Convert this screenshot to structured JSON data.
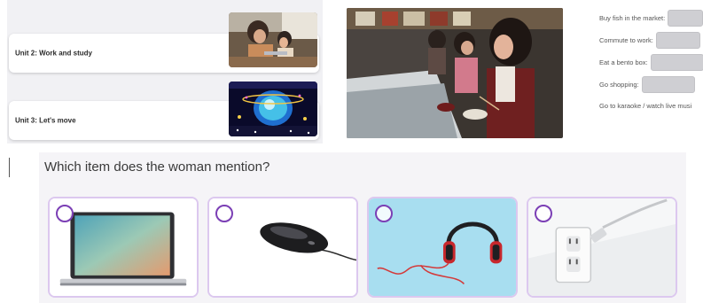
{
  "units": [
    {
      "title": "Unit 2: Work and study",
      "thumbnail_icon": "family-laptop-photo"
    },
    {
      "title": "Unit 3: Let's move",
      "thumbnail_icon": "concert-globe-photo"
    }
  ],
  "video": {
    "icon": "sushi-bar-diners-photo"
  },
  "activity_form": {
    "rows": [
      {
        "label": "Buy fish in the market:",
        "value": ""
      },
      {
        "label": "Commute to work:",
        "value": ""
      },
      {
        "label": "Eat a bento box:",
        "value": ""
      },
      {
        "label": "Go shopping:",
        "value": ""
      },
      {
        "label": "Go to karaoke / watch live musi"
      }
    ]
  },
  "quiz": {
    "question": "Which item does the woman mention?",
    "options": [
      {
        "icon": "laptop-icon"
      },
      {
        "icon": "mouse-icon"
      },
      {
        "icon": "headphones-icon"
      },
      {
        "icon": "power-outlet-icon"
      }
    ],
    "colors": {
      "radio": "#7b3fb5",
      "option_border": "#dcc8ef",
      "headphones_bg": "#a8def0"
    }
  }
}
